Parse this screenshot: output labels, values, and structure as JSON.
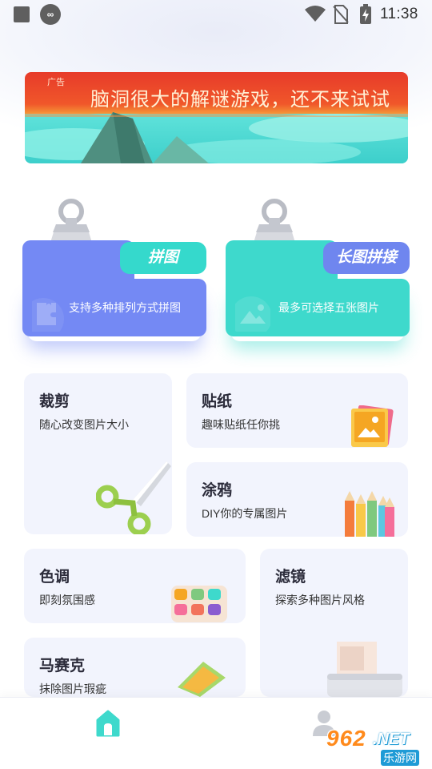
{
  "status_bar": {
    "time": "11:38",
    "left_icons": [
      "square-icon",
      "infinity-icon"
    ],
    "right_icons": [
      "wifi-icon",
      "no-sim-icon",
      "battery-charging-icon"
    ]
  },
  "banner": {
    "ad_tag": "广告",
    "text": "脑洞很大的解谜游戏，还不来试试"
  },
  "folders": [
    {
      "label": "拼图",
      "desc": "支持多种排列方式拼图",
      "color": "#7489f4",
      "tab_color": "#35d9cc"
    },
    {
      "label": "长图拼接",
      "desc": "最多可选择五张图片",
      "color": "#3ed9cc",
      "tab_color": "#6f86ef"
    }
  ],
  "cards": {
    "crop": {
      "title": "裁剪",
      "sub": "随心改变图片大小",
      "icon": "scissors-icon"
    },
    "sticker": {
      "title": "贴纸",
      "sub": "趣味贴纸任你挑",
      "icon": "photo-sticker-icon"
    },
    "doodle": {
      "title": "涂鸦",
      "sub": "DIY你的专属图片",
      "icon": "color-pencils-icon"
    },
    "tone": {
      "title": "色调",
      "sub": "即刻氛围感",
      "icon": "palette-icon"
    },
    "filter": {
      "title": "滤镜",
      "sub": "探索多种图片风格",
      "icon": "printer-icon"
    },
    "mosaic": {
      "title": "马赛克",
      "sub": "抹除图片瑕疵",
      "icon": "eraser-icon"
    }
  },
  "bottom_nav": {
    "items": [
      "home-icon",
      "profile-icon"
    ],
    "active": "home-icon",
    "accent": "#3ed9cc"
  },
  "watermark": {
    "number": "962",
    "domain": ".NET",
    "cn": "乐游网"
  }
}
